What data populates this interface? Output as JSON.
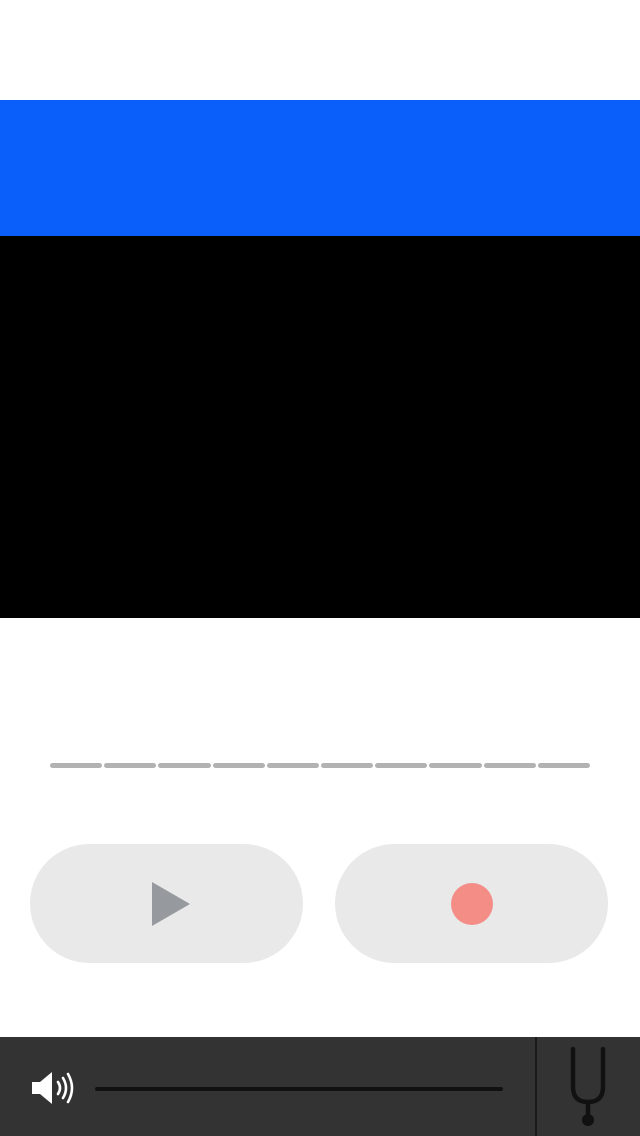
{
  "colors": {
    "banner": "#0a5ffb",
    "panel": "#000000",
    "meter_segment": "#b2b2b2",
    "button_bg": "#e9e9e9",
    "play_icon": "#96999e",
    "record_icon": "#f38d86",
    "bottom_bar": "#333333",
    "bottom_icon": "#ffffff",
    "volume_track": "#111111",
    "divider": "#1a1a1a",
    "fork_icon": "#111111"
  },
  "meter": {
    "segment_count": 10
  },
  "controls": {
    "play_icon": "play-icon",
    "record_icon": "record-icon"
  },
  "bottom_bar": {
    "speaker_icon": "speaker-volume-icon",
    "tuner_icon": "tuning-fork-icon"
  }
}
